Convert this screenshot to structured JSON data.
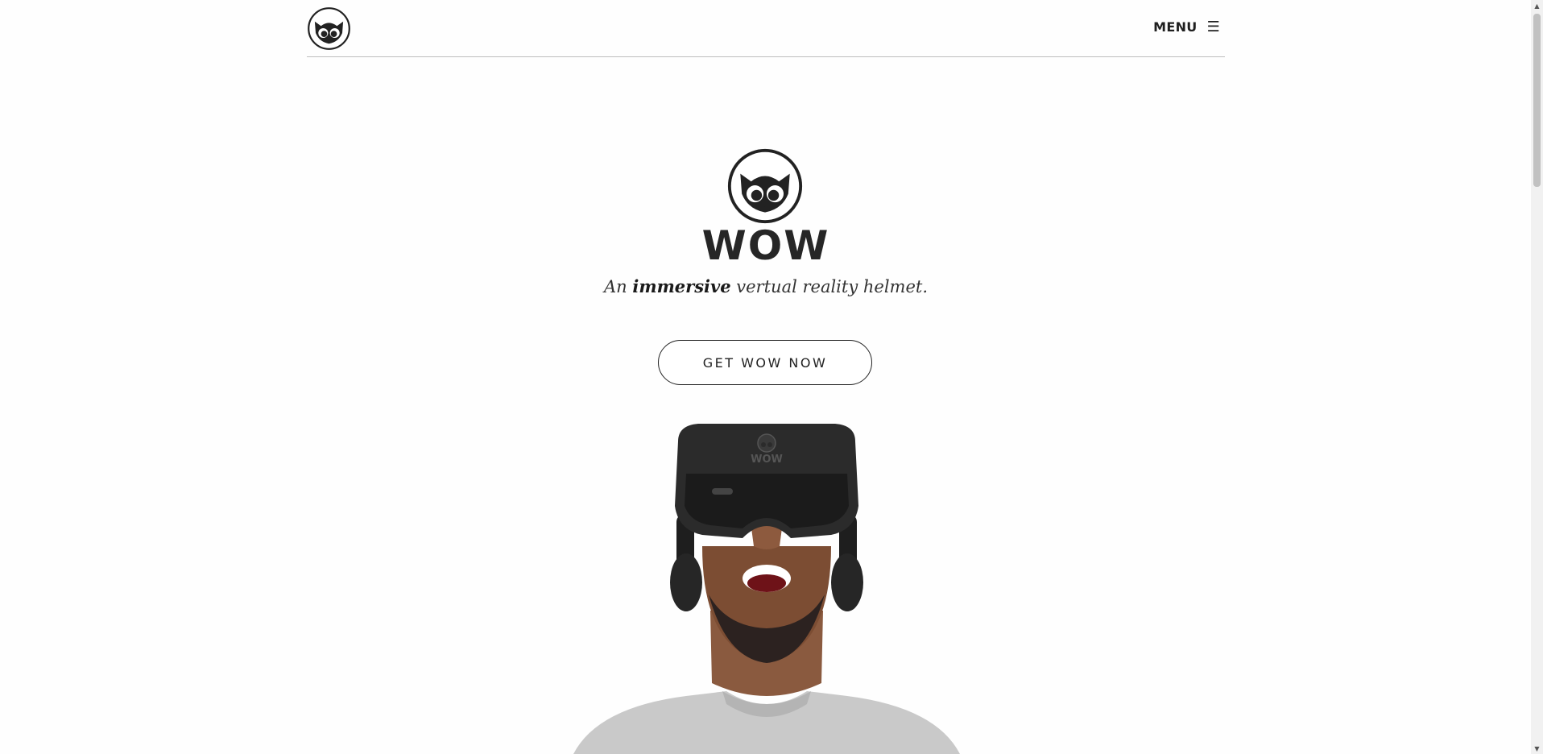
{
  "header": {
    "menu_label": "MENU",
    "menu_icon": "☰"
  },
  "hero": {
    "brand": "WOW",
    "tagline_pre": "An ",
    "tagline_em": "immersive",
    "tagline_post": " vertual reality helmet.",
    "cta_label": "GET WOW NOW",
    "helmet_logo_text": "WOW"
  },
  "icons": {
    "logo": "owl-logo-icon",
    "menu": "hamburger-icon",
    "photo": "vr-headset-person-image"
  },
  "colors": {
    "text": "#222222",
    "background": "#fefefe",
    "divider": "#bdbdbd"
  }
}
